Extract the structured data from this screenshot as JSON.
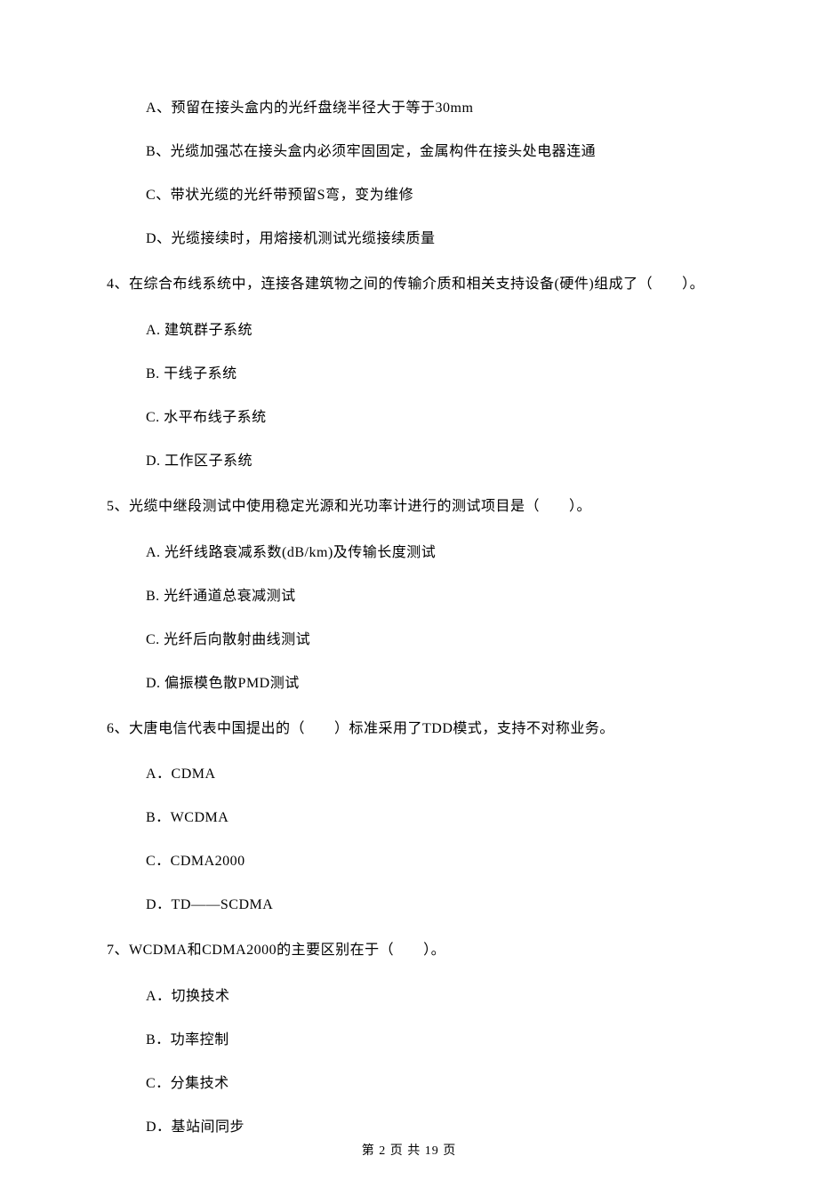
{
  "q3_options": {
    "a": "A、预留在接头盒内的光纤盘绕半径大于等于30mm",
    "b": "B、光缆加强芯在接头盒内必须牢固固定，金属构件在接头处电器连通",
    "c": "C、带状光缆的光纤带预留S弯，变为维修",
    "d": "D、光缆接续时，用熔接机测试光缆接续质量"
  },
  "q4": {
    "stem": "4、在综合布线系统中，连接各建筑物之间的传输介质和相关支持设备(硬件)组成了（　　）。",
    "a": "A. 建筑群子系统",
    "b": "B. 干线子系统",
    "c": "C. 水平布线子系统",
    "d": "D. 工作区子系统"
  },
  "q5": {
    "stem": "5、光缆中继段测试中使用稳定光源和光功率计进行的测试项目是（　　）。",
    "a": "A. 光纤线路衰减系数(dB/km)及传输长度测试",
    "b": "B. 光纤通道总衰减测试",
    "c": "C. 光纤后向散射曲线测试",
    "d": "D. 偏振模色散PMD测试"
  },
  "q6": {
    "stem": "6、大唐电信代表中国提出的（　　）标准采用了TDD模式，支持不对称业务。",
    "a": "A．CDMA",
    "b": "B．WCDMA",
    "c": "C．CDMA2000",
    "d": "D．TD——SCDMA"
  },
  "q7": {
    "stem": "7、WCDMA和CDMA2000的主要区别在于（　　）。",
    "a": "A．切换技术",
    "b": "B．功率控制",
    "c": "C．分集技术",
    "d": "D．基站间同步"
  },
  "footer": "第 2 页 共 19 页"
}
